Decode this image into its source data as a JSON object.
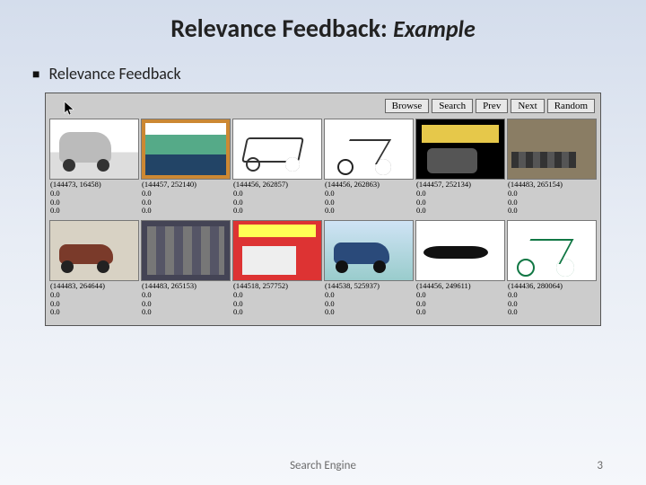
{
  "title_main": "Relevance Feedback: ",
  "title_accent": "Example",
  "bullet": "Relevance Feedback",
  "toolbar": {
    "browse": "Browse",
    "search": "Search",
    "prev": "Prev",
    "next": "Next",
    "random": "Random"
  },
  "results": [
    {
      "coords": "(144473, 16458)",
      "v1": "0.0",
      "v2": "0.0",
      "v3": "0.0",
      "art": "scooter"
    },
    {
      "coords": "(144457, 252140)",
      "v1": "0.0",
      "v2": "0.0",
      "v3": "0.0",
      "art": "mag1"
    },
    {
      "coords": "(144456, 262857)",
      "v1": "0.0",
      "v2": "0.0",
      "v3": "0.0",
      "art": "fold"
    },
    {
      "coords": "(144456, 262863)",
      "v1": "0.0",
      "v2": "0.0",
      "v3": "0.0",
      "art": "bike1"
    },
    {
      "coords": "(144457, 252134)",
      "v1": "0.0",
      "v2": "0.0",
      "v3": "0.0",
      "art": "cover"
    },
    {
      "coords": "(144483, 265154)",
      "v1": "0.0",
      "v2": "0.0",
      "v3": "0.0",
      "art": "row"
    },
    {
      "coords": "(144483, 264644)",
      "v1": "0.0",
      "v2": "0.0",
      "v3": "0.0",
      "art": "moto"
    },
    {
      "coords": "(144483, 265153)",
      "v1": "0.0",
      "v2": "0.0",
      "v3": "0.0",
      "art": "shop"
    },
    {
      "coords": "(144518, 257752)",
      "v1": "0.0",
      "v2": "0.0",
      "v3": "0.0",
      "art": "mag2"
    },
    {
      "coords": "(144538, 525937)",
      "v1": "0.0",
      "v2": "0.0",
      "v3": "0.0",
      "art": "blue"
    },
    {
      "coords": "(144456, 249611)",
      "v1": "0.0",
      "v2": "0.0",
      "v3": "0.0",
      "art": "fender"
    },
    {
      "coords": "(144436, 280064)",
      "v1": "0.0",
      "v2": "0.0",
      "v3": "0.0",
      "art": "mtb"
    }
  ],
  "footer_center": "Search Engine",
  "footer_right": "3"
}
